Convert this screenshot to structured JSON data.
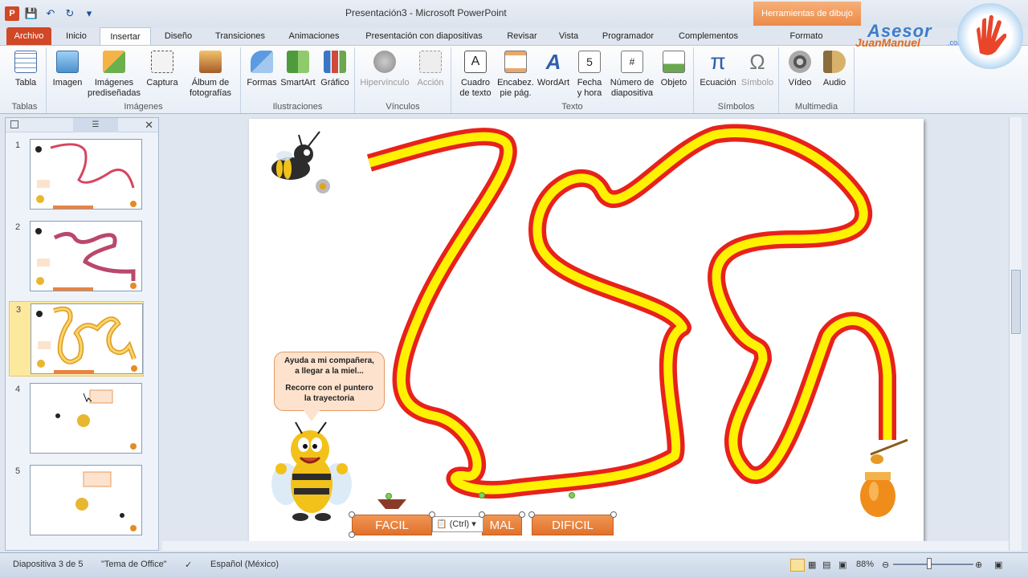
{
  "window": {
    "title": "Presentación3 - Microsoft PowerPoint",
    "contextual_tab": "Herramientas de dibujo"
  },
  "tabs": {
    "file": "Archivo",
    "items": [
      "Inicio",
      "Insertar",
      "Diseño",
      "Transiciones",
      "Animaciones",
      "Presentación con diapositivas",
      "Revisar",
      "Vista",
      "Programador",
      "Complementos",
      "Formato"
    ]
  },
  "ribbon": {
    "groups": {
      "tablas": "Tablas",
      "imagenes": "Imágenes",
      "ilustraciones": "Ilustraciones",
      "vinculos": "Vínculos",
      "texto": "Texto",
      "simbolos": "Símbolos",
      "multimedia": "Multimedia"
    },
    "buttons": {
      "tabla": "Tabla",
      "imagen": "Imagen",
      "imagenes_pre_1": "Imágenes",
      "imagenes_pre_2": "prediseñadas",
      "captura": "Captura",
      "album_1": "Álbum de",
      "album_2": "fotografías",
      "formas": "Formas",
      "smartart": "SmartArt",
      "grafico": "Gráfico",
      "hipervinculo": "Hipervínculo",
      "accion": "Acción",
      "cuadro_1": "Cuadro",
      "cuadro_2": "de texto",
      "encabez_1": "Encabez.",
      "encabez_2": "pie pág.",
      "wordart": "WordArt",
      "fecha_1": "Fecha",
      "fecha_2": "y hora",
      "numero_1": "Número de",
      "numero_2": "diapositiva",
      "objeto": "Objeto",
      "ecuacion": "Ecuación",
      "simbolo": "Símbolo",
      "video": "Vídeo",
      "audio": "Audio"
    },
    "brand": {
      "line1": "Asesor",
      "line2": "JuanManuel",
      "suffix": ".com"
    }
  },
  "slides_panel": {
    "numbers": [
      "1",
      "2",
      "3",
      "4",
      "5"
    ],
    "selected": "3"
  },
  "slide": {
    "bubble_line1": "Ayuda a mi compañera,",
    "bubble_line2": "a llegar a la miel...",
    "bubble_line3": "Recorre con el puntero",
    "bubble_line4": "la trayectoria",
    "btn_easy": "FACIL",
    "btn_normal": "MAL",
    "btn_hard": "DIFICIL",
    "paste_label": "(Ctrl)"
  },
  "status": {
    "slide_info": "Diapositiva 3 de 5",
    "theme": "\"Tema de Office\"",
    "language": "Español (México)",
    "zoom": "88%"
  },
  "colors": {
    "path_outer": "#e8211b",
    "path_inner": "#fff200",
    "accent": "#d24726",
    "button": "#e98343"
  }
}
